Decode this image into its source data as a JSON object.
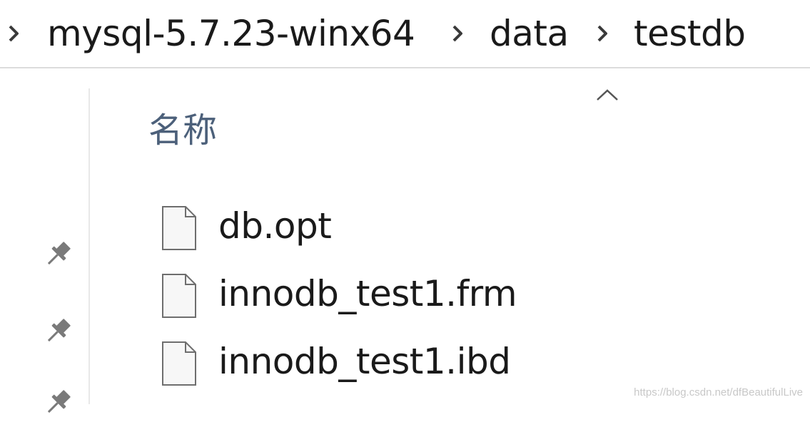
{
  "breadcrumb": {
    "items": [
      {
        "label": "mysql-5.7.23-winx64"
      },
      {
        "label": "data"
      },
      {
        "label": "testdb"
      }
    ]
  },
  "columns": {
    "name_header": "名称",
    "sort_direction": "ascending"
  },
  "files": [
    {
      "name": "db.opt",
      "icon": "file-icon"
    },
    {
      "name": "innodb_test1.frm",
      "icon": "file-icon"
    },
    {
      "name": "innodb_test1.ibd",
      "icon": "file-icon"
    }
  ],
  "nav_pane": {
    "pinned_icon": "pin-icon"
  },
  "watermark": "https://blog.csdn.net/dfBeautifulLive",
  "colors": {
    "header_text": "#4c607a",
    "text": "#1a1a1a",
    "divider": "#dcdcdc",
    "icon_stroke": "#6e6e6e",
    "pin": "#7a7a7a"
  }
}
